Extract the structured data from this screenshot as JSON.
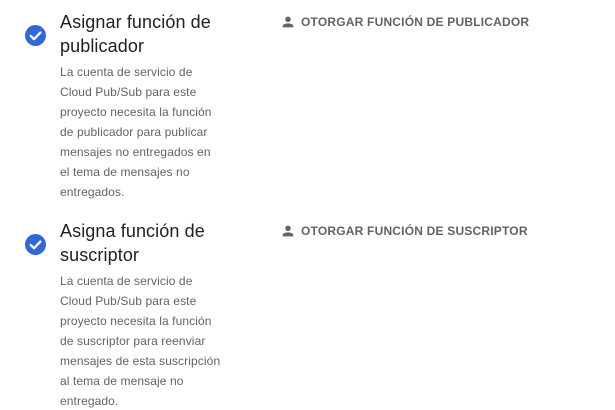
{
  "colors": {
    "check_fill": "#3367d6",
    "title_text": "#202124",
    "secondary_text": "#5f6368"
  },
  "steps": [
    {
      "status_icon": "check-circle-icon",
      "title_lines": [
        "Asignar función de",
        "publicador"
      ],
      "description_lines": [
        "La cuenta de servicio de",
        "Cloud Pub/Sub para este",
        "proyecto necesita la función",
        "de publicador para publicar",
        "mensajes no entregados en",
        "el tema de mensajes no",
        "entregados."
      ],
      "action": {
        "icon": "person-icon",
        "label": "OTORGAR FUNCIÓN DE PUBLICADOR"
      }
    },
    {
      "status_icon": "check-circle-icon",
      "title_lines": [
        "Asigna función de",
        "suscriptor"
      ],
      "description_lines": [
        "La cuenta de servicio de",
        "Cloud Pub/Sub para este",
        "proyecto necesita la función",
        "de suscriptor para reenviar",
        "mensajes de esta suscripción",
        "al tema de mensaje no",
        "entregado."
      ],
      "action": {
        "icon": "person-icon",
        "label": "OTORGAR FUNCIÓN DE SUSCRIPTOR"
      }
    }
  ]
}
